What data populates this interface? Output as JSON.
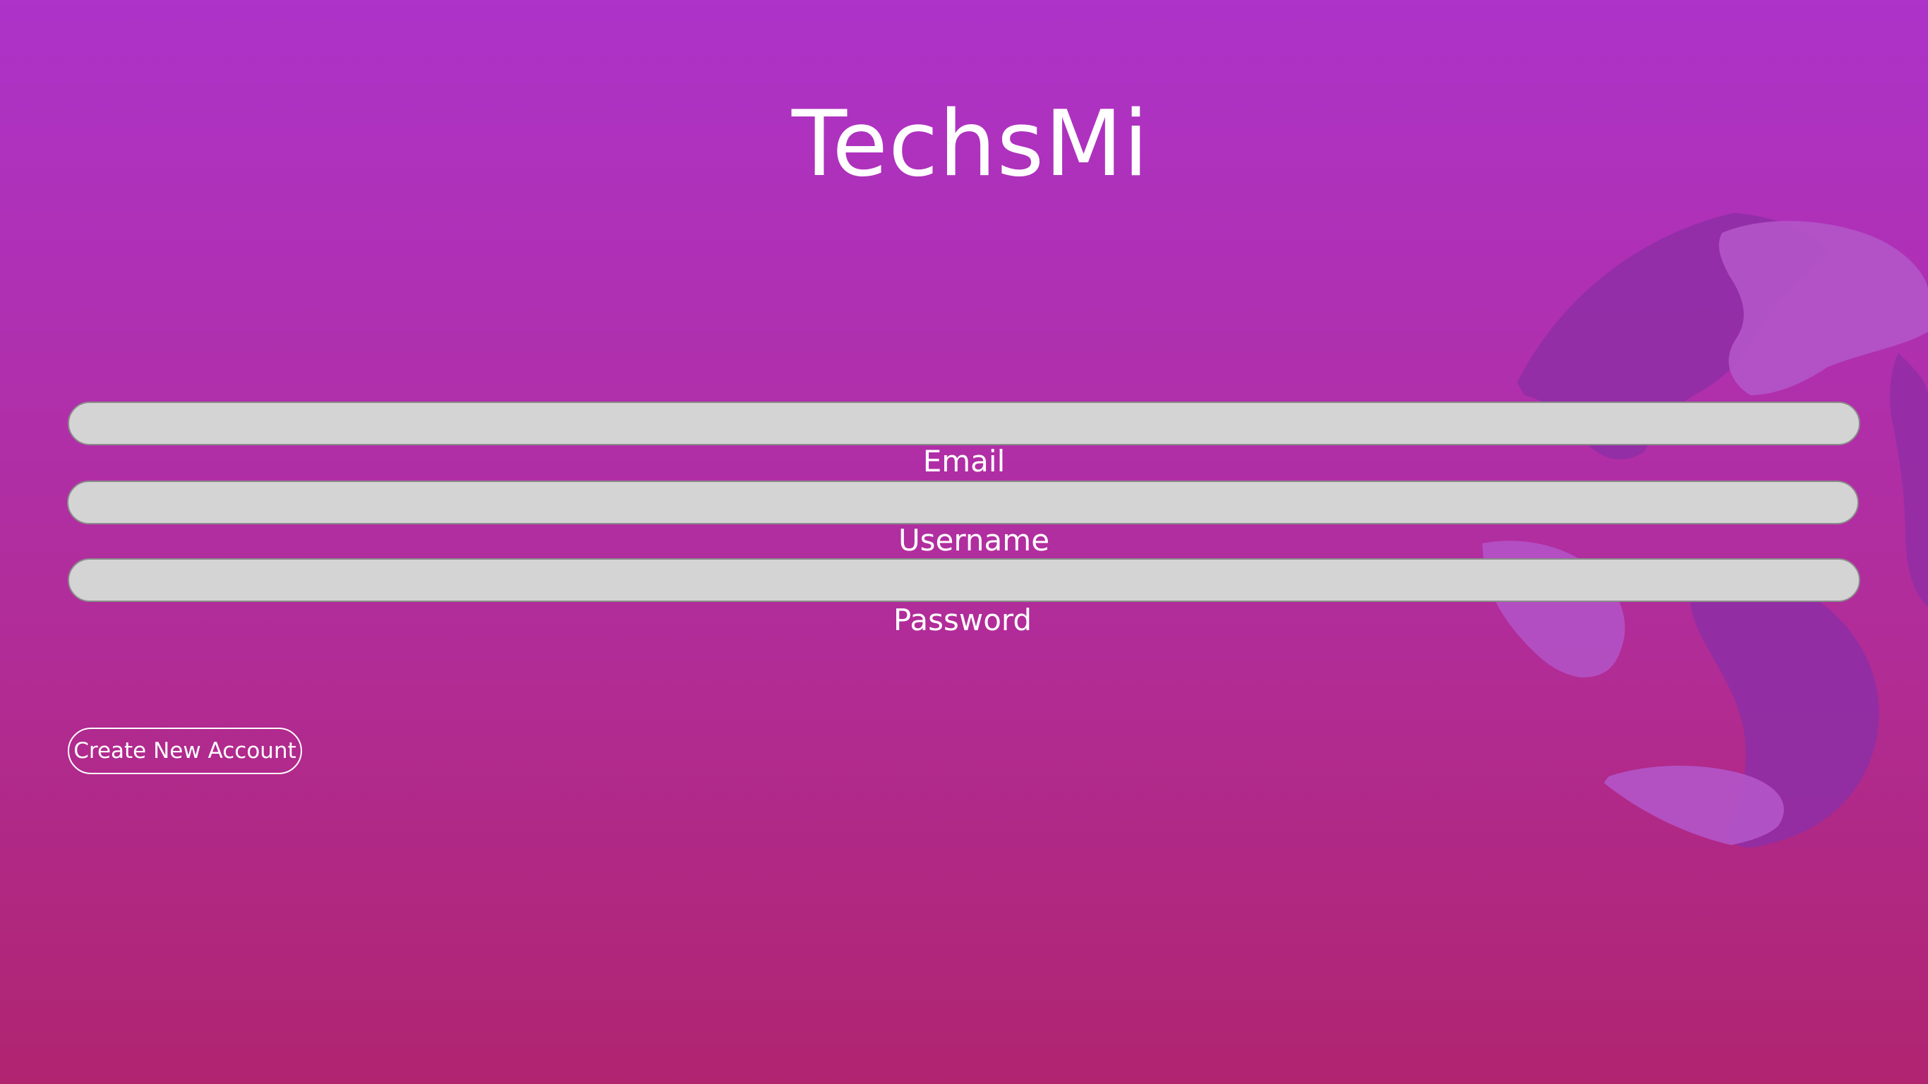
{
  "app": {
    "title": "TechsMi"
  },
  "form": {
    "email": {
      "label": "Email",
      "value": ""
    },
    "username": {
      "label": "Username",
      "value": ""
    },
    "password": {
      "label": "Password",
      "value": ""
    }
  },
  "actions": {
    "create_account_label": "Create New Account"
  },
  "background": {
    "graphic": "globe-world-map",
    "gradient_top": "#ad33c9",
    "gradient_bottom": "#b02470"
  },
  "colors": {
    "field_fill": "#d4d4d4",
    "field_border": "#8a8a8a",
    "text": "#ffffff"
  }
}
